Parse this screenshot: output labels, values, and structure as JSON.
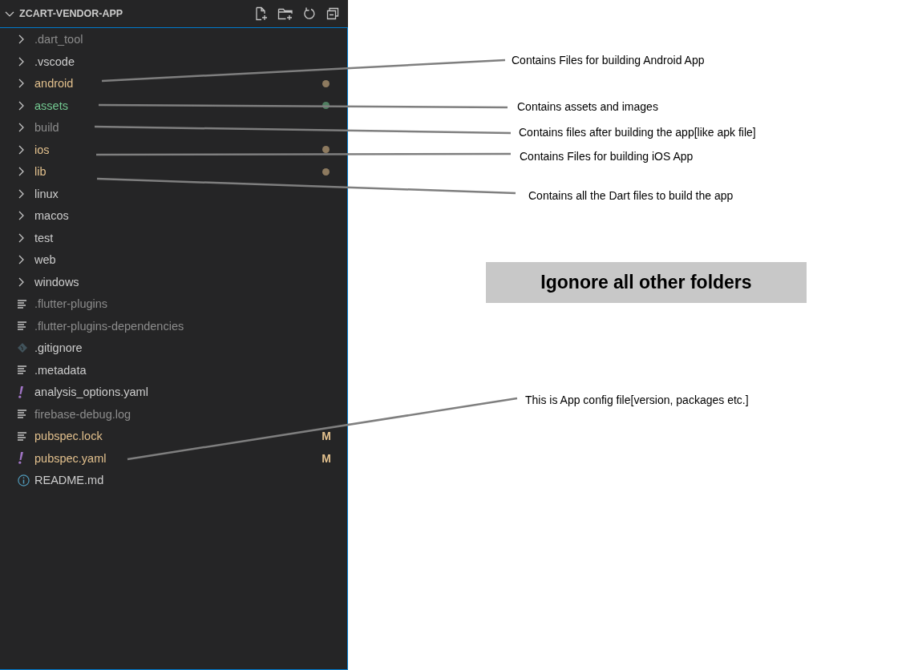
{
  "explorer": {
    "title": "ZCART-VENDOR-APP",
    "expanded": true
  },
  "items": [
    {
      "kind": "folder",
      "name": ".dart_tool",
      "color": "#8c8c8c",
      "expanded": false
    },
    {
      "kind": "folder",
      "name": ".vscode",
      "color": "#cccccc",
      "expanded": false
    },
    {
      "kind": "folder",
      "name": "android",
      "color": "#e2c08d",
      "expanded": false,
      "dot": true
    },
    {
      "kind": "folder",
      "name": "assets",
      "color": "#73c991",
      "expanded": false,
      "dot": true
    },
    {
      "kind": "folder",
      "name": "build",
      "color": "#8c8c8c",
      "expanded": false
    },
    {
      "kind": "folder",
      "name": "ios",
      "color": "#e2c08d",
      "expanded": false,
      "dot": true
    },
    {
      "kind": "folder",
      "name": "lib",
      "color": "#e2c08d",
      "expanded": false,
      "dot": true
    },
    {
      "kind": "folder",
      "name": "linux",
      "color": "#cccccc",
      "expanded": false
    },
    {
      "kind": "folder",
      "name": "macos",
      "color": "#cccccc",
      "expanded": false
    },
    {
      "kind": "folder",
      "name": "test",
      "color": "#cccccc",
      "expanded": false
    },
    {
      "kind": "folder",
      "name": "web",
      "color": "#cccccc",
      "expanded": false
    },
    {
      "kind": "folder",
      "name": "windows",
      "color": "#cccccc",
      "expanded": false
    },
    {
      "kind": "text",
      "name": ".flutter-plugins",
      "color": "#8c8c8c"
    },
    {
      "kind": "text",
      "name": ".flutter-plugins-dependencies",
      "color": "#8c8c8c"
    },
    {
      "kind": "git",
      "name": ".gitignore",
      "color": "#cccccc"
    },
    {
      "kind": "text",
      "name": ".metadata",
      "color": "#cccccc"
    },
    {
      "kind": "yaml",
      "name": "analysis_options.yaml",
      "color": "#cccccc"
    },
    {
      "kind": "text",
      "name": "firebase-debug.log",
      "color": "#8c8c8c"
    },
    {
      "kind": "text",
      "name": "pubspec.lock",
      "color": "#e2c08d",
      "badge": "M"
    },
    {
      "kind": "yaml",
      "name": "pubspec.yaml",
      "color": "#e2c08d",
      "badge": "M"
    },
    {
      "kind": "info",
      "name": "README.md",
      "color": "#cccccc"
    }
  ],
  "annotations": [
    {
      "text": "Contains Files for building Android App"
    },
    {
      "text": "Contains assets and images"
    },
    {
      "text": "Contains files after building the app[like apk file]"
    },
    {
      "text": "Contains Files for building iOS App"
    },
    {
      "text": "Contains all the Dart files to build the app"
    },
    {
      "text": "This is App config file[version, packages etc.]"
    }
  ],
  "callout": {
    "text": "Igonore all other folders"
  }
}
